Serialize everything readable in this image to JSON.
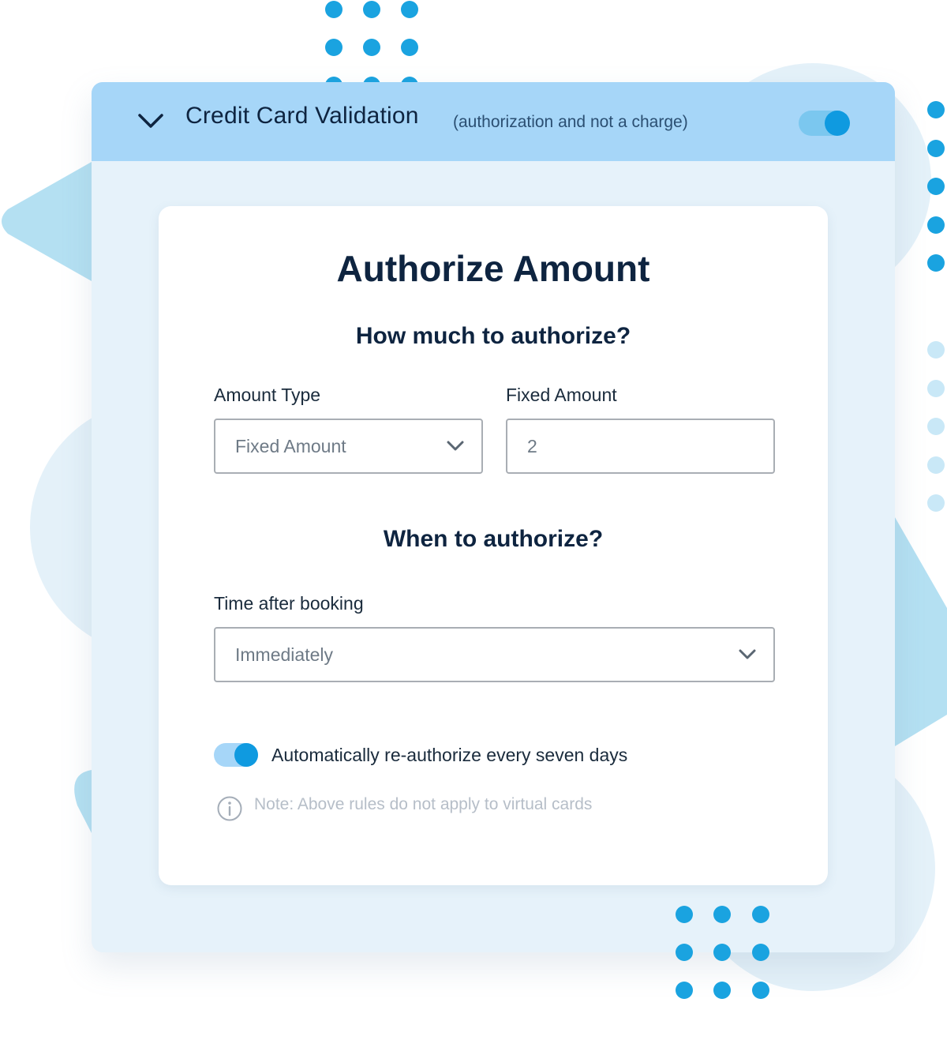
{
  "header": {
    "title": "Credit Card Validation",
    "subtitle": "(authorization and not a charge)",
    "toggle_on": true
  },
  "card": {
    "title": "Authorize Amount",
    "section_amount": "How much to authorize?",
    "amount_type": {
      "label": "Amount Type",
      "value": "Fixed Amount"
    },
    "fixed_amount": {
      "label": "Fixed Amount",
      "value": "2"
    },
    "section_when": "When to authorize?",
    "time_after_booking": {
      "label": "Time after booking",
      "value": "Immediately"
    },
    "reauthorize": {
      "label": "Automatically re-authorize every seven days",
      "on": true
    },
    "note": "Note: Above rules do not apply to virtual cards"
  },
  "colors": {
    "accent": "#0f9ae0",
    "toggle_track": "#7bc7ef",
    "header_bg": "#a6d6f8",
    "panel_bg": "#e6f2fa",
    "title_text": "#0e2440"
  }
}
